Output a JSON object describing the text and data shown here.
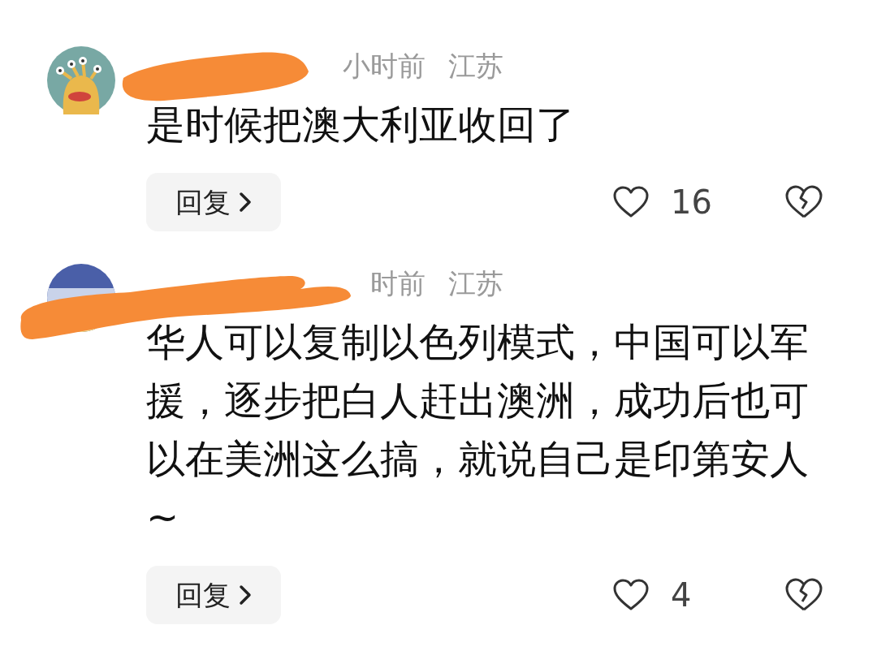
{
  "comments": [
    {
      "avatar": {
        "kind": "illustration"
      },
      "time": "小时前",
      "location": "江苏",
      "text": "是时候把澳大利亚收回了",
      "reply": "回复",
      "likes": "16"
    },
    {
      "time": "时前",
      "location": "江苏",
      "text": "华人可以复制以色列模式，中国可以军援，逐步把白人赶出澳洲，成功后也可以在美洲这么搞，就说自己是印第安人 ~",
      "reply": "回复",
      "likes": "4"
    }
  ]
}
